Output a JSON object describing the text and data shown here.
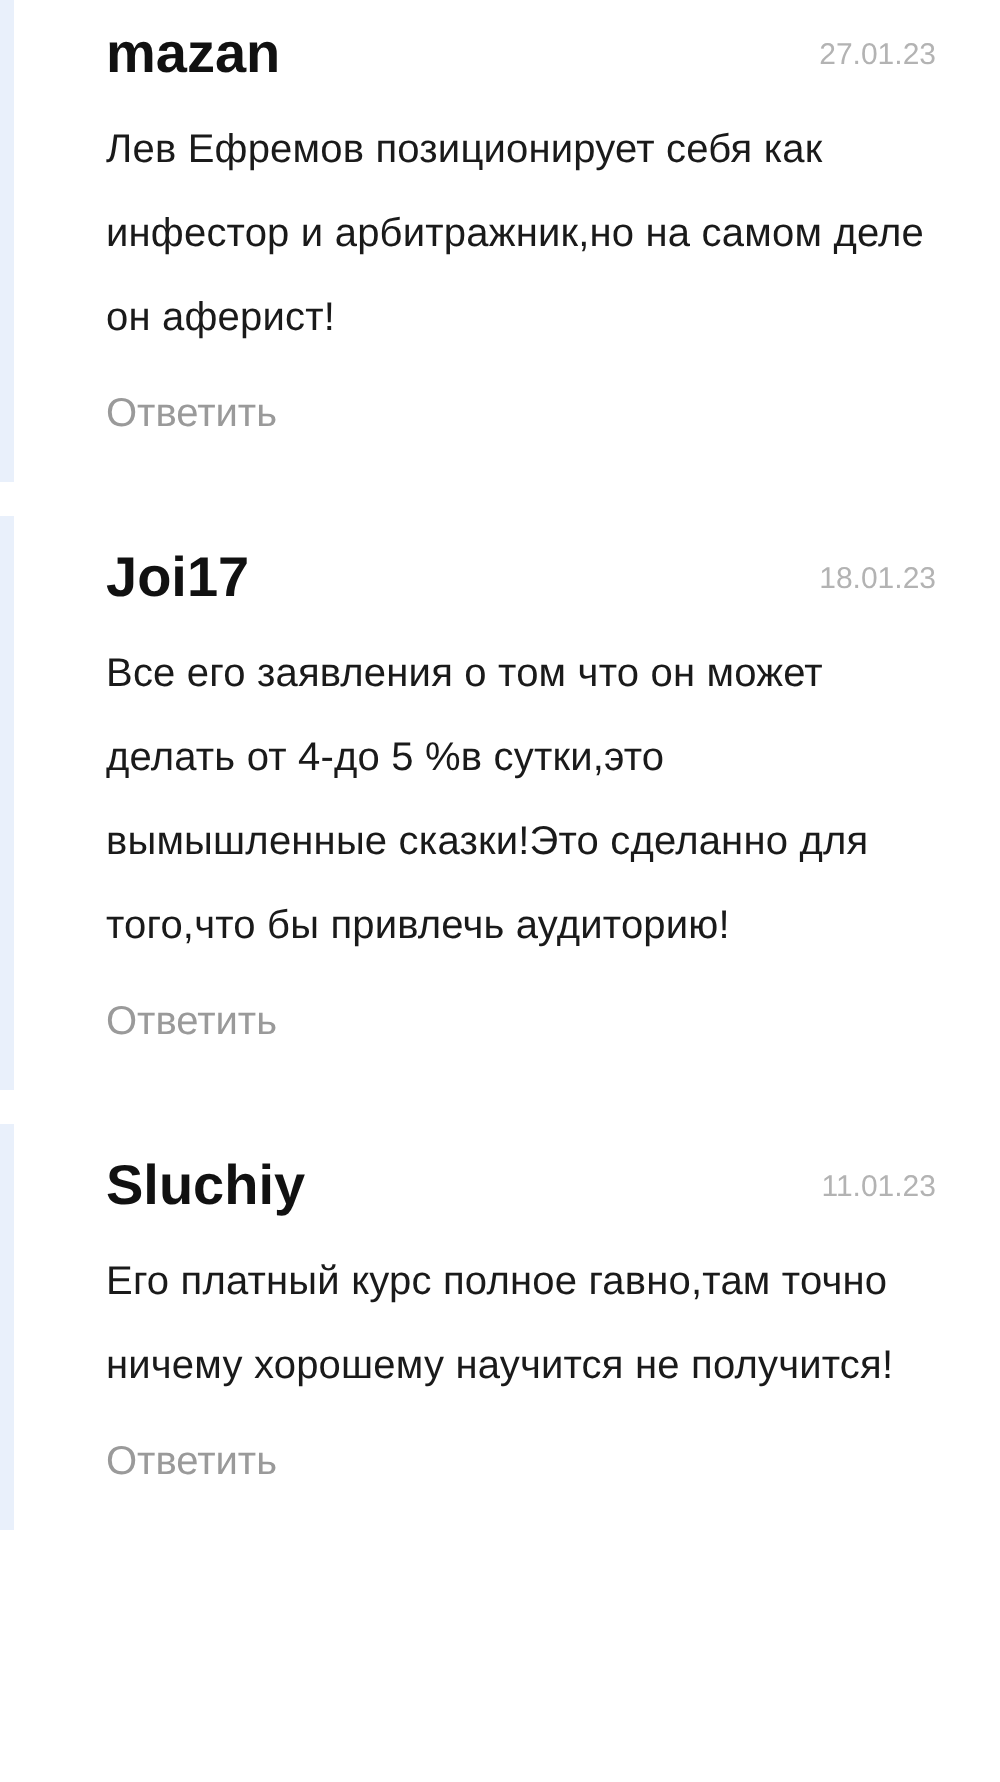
{
  "comments": [
    {
      "author": "mazan",
      "date": "27.01.23",
      "text": "Лев Ефремов позиционирует себя как инфестор и арбитражник,но на самом деле он аферист!",
      "reply": "Ответить"
    },
    {
      "author": "Joi17",
      "date": "18.01.23",
      "text": "Все его заявления о том что он может делать от 4-до 5 %в сутки,это вымышленные сказки!Это сделанно для того,что бы привлечь аудиторию!",
      "reply": "Ответить"
    },
    {
      "author": "Sluchiy",
      "date": "11.01.23",
      "text": "Его платный курс полное гавно,там точно ничему хорошему научится не получится!",
      "reply": "Ответить"
    }
  ]
}
